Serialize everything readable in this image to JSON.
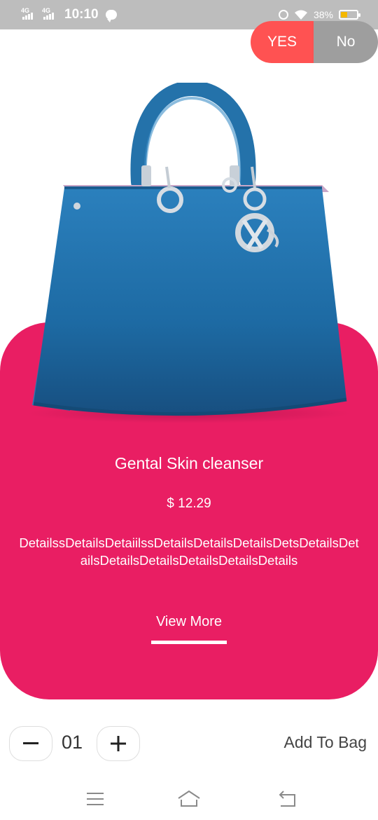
{
  "status_bar": {
    "network_1": "4G",
    "network_2": "4G",
    "time": "10:10",
    "battery": "38%",
    "icons": [
      "signal-icon",
      "chat-bubble-icon",
      "alarm-icon",
      "wifi-icon",
      "battery-icon"
    ]
  },
  "toggle": {
    "yes_label": "YES",
    "no_label": "No",
    "selected": "YES"
  },
  "product": {
    "title": "Gental Skin cleanser",
    "price": "$ 12.29",
    "details": "DetailssDetailsDetaiilssDetailsDetailsDetailsDetsDetailsDetailsDetailsDetailsDetailsDetailsDetails",
    "image_icon": "blue-handbag-image"
  },
  "actions": {
    "view_more": "View More",
    "quantity": "01",
    "add_to_bag": "Add To Bag"
  },
  "nav": {
    "icons": [
      "menu-icon",
      "home-icon",
      "back-icon"
    ]
  },
  "colors": {
    "accent": "#e91e63",
    "toggle_yes": "#ff5252",
    "toggle_no": "#9e9e9e",
    "status_bar": "#bdbdbd",
    "bag_blue": "#1f6fa8"
  }
}
